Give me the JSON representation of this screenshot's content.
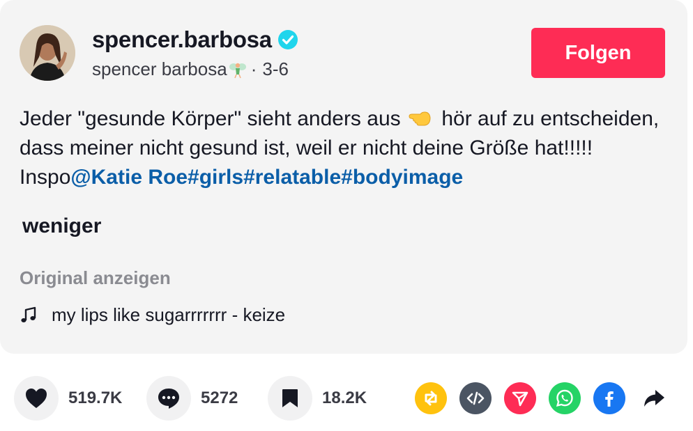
{
  "author": {
    "username": "spencer.barbosa",
    "display_name": "spencer barbosa",
    "date": "3-6",
    "separator": "·",
    "verified": true,
    "avatar_icon": "profile-photo"
  },
  "follow_button": {
    "label": "Folgen",
    "color": "#fe2c55"
  },
  "description": {
    "text_1": "Jeder \"gesunde Körper\" sieht anders aus",
    "text_2": "hör auf zu entscheiden, dass meiner nicht gesund ist, weil er nicht deine Größe hat!!!!! Inspo",
    "mention": "@Katie Roe",
    "hashtags": [
      "#girls",
      "#relatable",
      "#bodyimage"
    ],
    "emoji_icon": "backhand-index-pointing-left-icon",
    "link_color": "#0b5ea8"
  },
  "less_label": "weniger",
  "translate_label": "Original anzeigen",
  "music": {
    "icon": "music-note-icon",
    "title": "my lips like sugarrrrrrr - keize"
  },
  "stats": {
    "likes": "519.7K",
    "comments": "5272",
    "saves": "18.2K"
  },
  "share_buttons": [
    {
      "name": "repost-icon",
      "color": "#ffc20e"
    },
    {
      "name": "embed-icon",
      "color": "#4b5563"
    },
    {
      "name": "send-to-friends-icon",
      "color": "#fe2c55"
    },
    {
      "name": "whatsapp-icon",
      "color": "#25d366"
    },
    {
      "name": "facebook-icon",
      "color": "#1877f2"
    },
    {
      "name": "share-arrow-icon",
      "color": "#161823"
    }
  ]
}
